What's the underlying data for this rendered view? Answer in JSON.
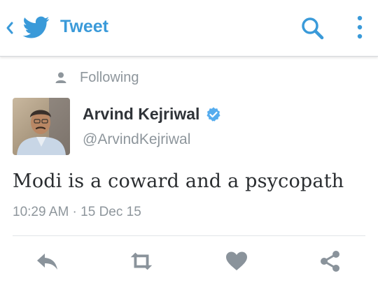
{
  "header": {
    "title": "Tweet",
    "back_icon": "chevron-left-icon",
    "logo_icon": "twitter-bird-icon",
    "search_icon": "search-icon",
    "menu_icon": "more-vertical-icon"
  },
  "context": {
    "label": "Following",
    "icon": "person-icon"
  },
  "author": {
    "name": "Arvind Kejriwal",
    "handle": "@ArvindKejriwal",
    "verified": true,
    "verified_icon": "verified-badge-icon"
  },
  "tweet": {
    "text": "Modi is a coward and a psycopath",
    "timestamp": "10:29 AM · 15 Dec 15"
  },
  "actions": [
    {
      "name": "reply",
      "icon": "reply-icon"
    },
    {
      "name": "retweet",
      "icon": "retweet-icon"
    },
    {
      "name": "like",
      "icon": "heart-icon"
    },
    {
      "name": "share",
      "icon": "share-icon"
    }
  ],
  "colors": {
    "accent": "#3a9ad9",
    "muted_text": "#8e969c",
    "icon_gray": "#8a939b",
    "verified": "#55acee"
  }
}
